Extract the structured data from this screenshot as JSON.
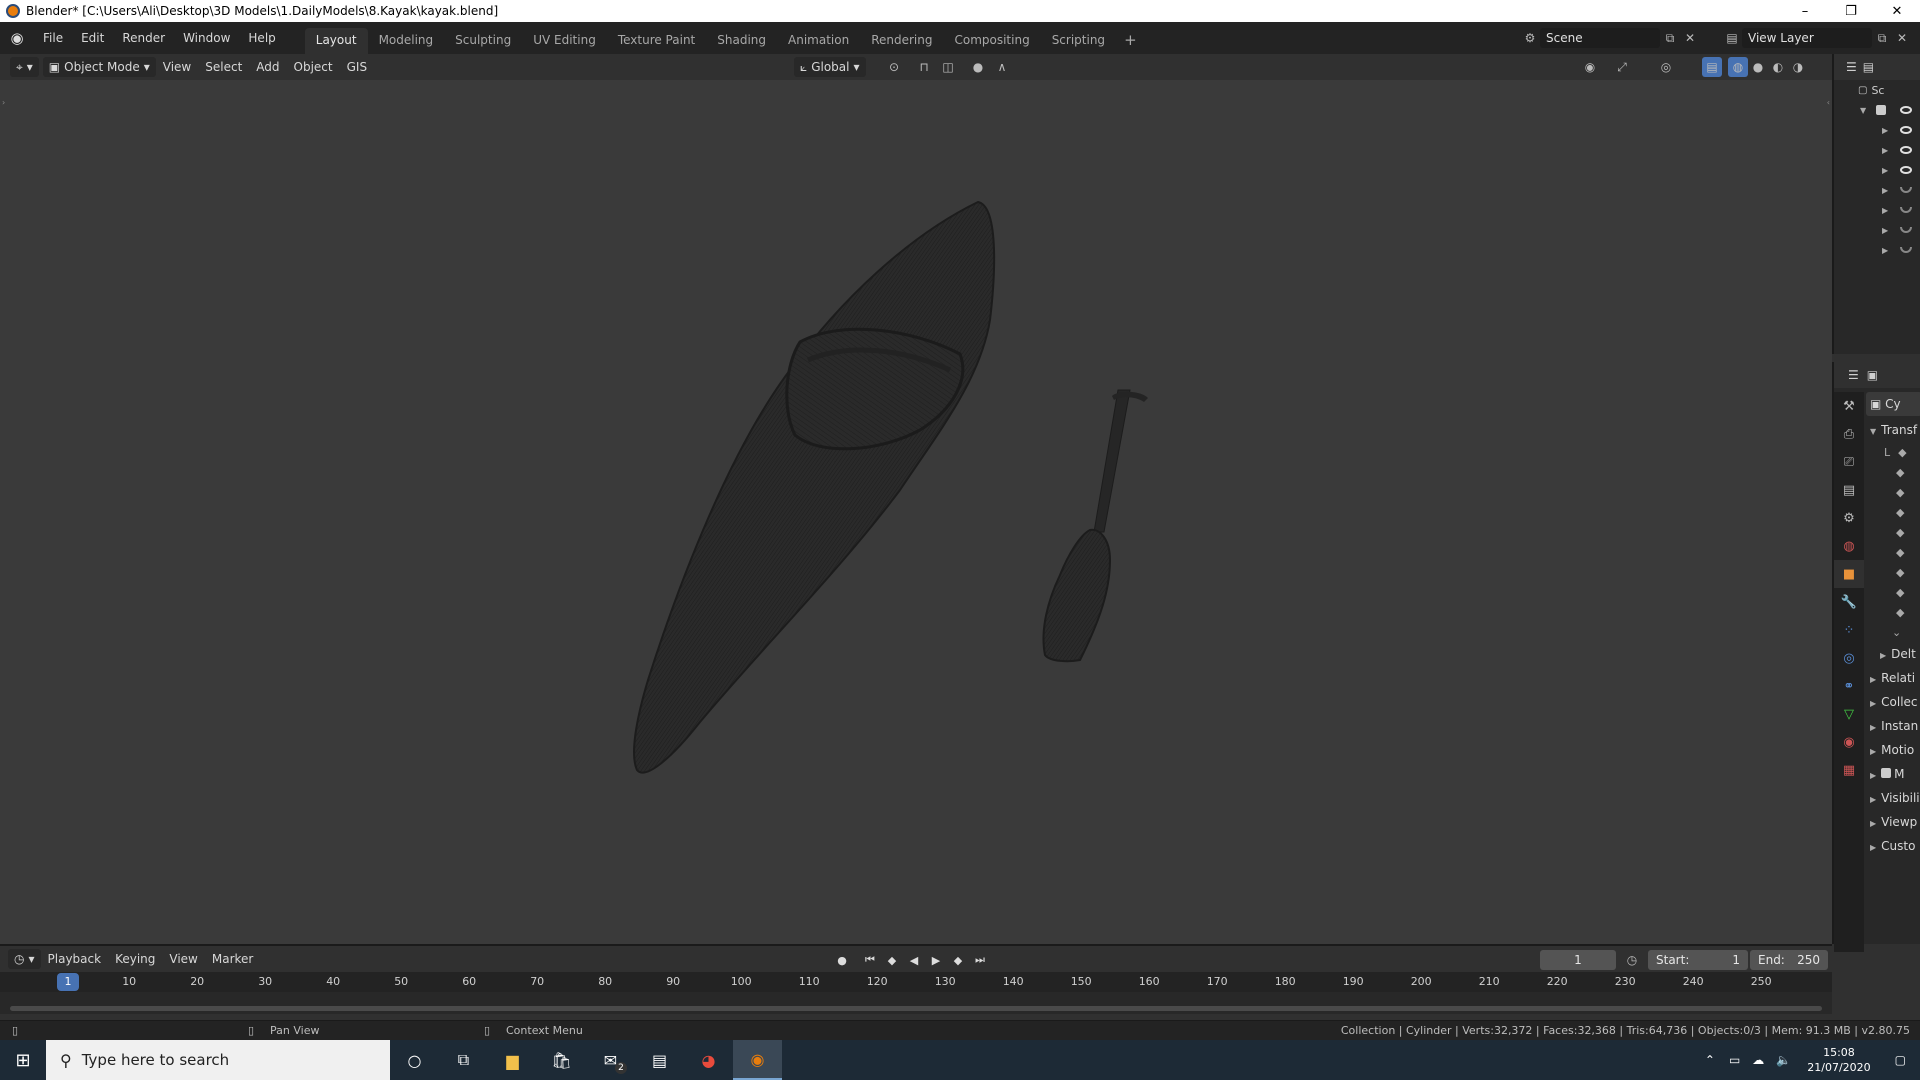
{
  "window": {
    "title": "Blender* [C:\\Users\\Ali\\Desktop\\3D Models\\1.DailyModels\\8.Kayak\\kayak.blend]",
    "controls": [
      "–",
      "❐",
      "✕"
    ]
  },
  "menu": [
    "File",
    "Edit",
    "Render",
    "Window",
    "Help"
  ],
  "workspaces": [
    "Layout",
    "Modeling",
    "Sculpting",
    "UV Editing",
    "Texture Paint",
    "Shading",
    "Animation",
    "Rendering",
    "Compositing",
    "Scripting"
  ],
  "workspace_add": "+",
  "scene": {
    "name": "Scene"
  },
  "view_layer": {
    "name": "View Layer"
  },
  "viewport_header": {
    "mode": "Object Mode",
    "menus": [
      "View",
      "Select",
      "Add",
      "Object",
      "GIS"
    ],
    "orientation": "Global"
  },
  "outliner": {
    "header": "Sc"
  },
  "properties": {
    "object_name": "Cy",
    "panels": [
      "Transf",
      "Delt",
      "Relati",
      "Collec",
      "Instan",
      "Motio",
      "M",
      "Visibili",
      "Viewp",
      "Custo"
    ],
    "l_label": "L"
  },
  "timeline": {
    "menus": [
      "Playback",
      "Keying",
      "View",
      "Marker"
    ],
    "current_frame": "1",
    "start_label": "Start:",
    "start": "1",
    "end_label": "End:",
    "end": "250",
    "ruler_ticks": [
      "10",
      "20",
      "30",
      "40",
      "50",
      "60",
      "70",
      "80",
      "90",
      "100",
      "110",
      "120",
      "130",
      "140",
      "150",
      "160",
      "170",
      "180",
      "190",
      "200",
      "210",
      "220",
      "230",
      "240",
      "250"
    ],
    "playhead": "1"
  },
  "statusbar": {
    "pan": "Pan View",
    "context": "Context Menu",
    "stats": "Collection | Cylinder | Verts:32,372 | Faces:32,368 | Tris:64,736 | Objects:0/3 | Mem: 91.3 MB | v2.80.75"
  },
  "taskbar": {
    "search_placeholder": "Type here to search",
    "time": "15:08",
    "date": "21/07/2020",
    "mail_badge": "2"
  },
  "colors": {
    "accent": "#4772b3",
    "viewport_bg": "#3a3a3a",
    "mesh": "#262626"
  }
}
